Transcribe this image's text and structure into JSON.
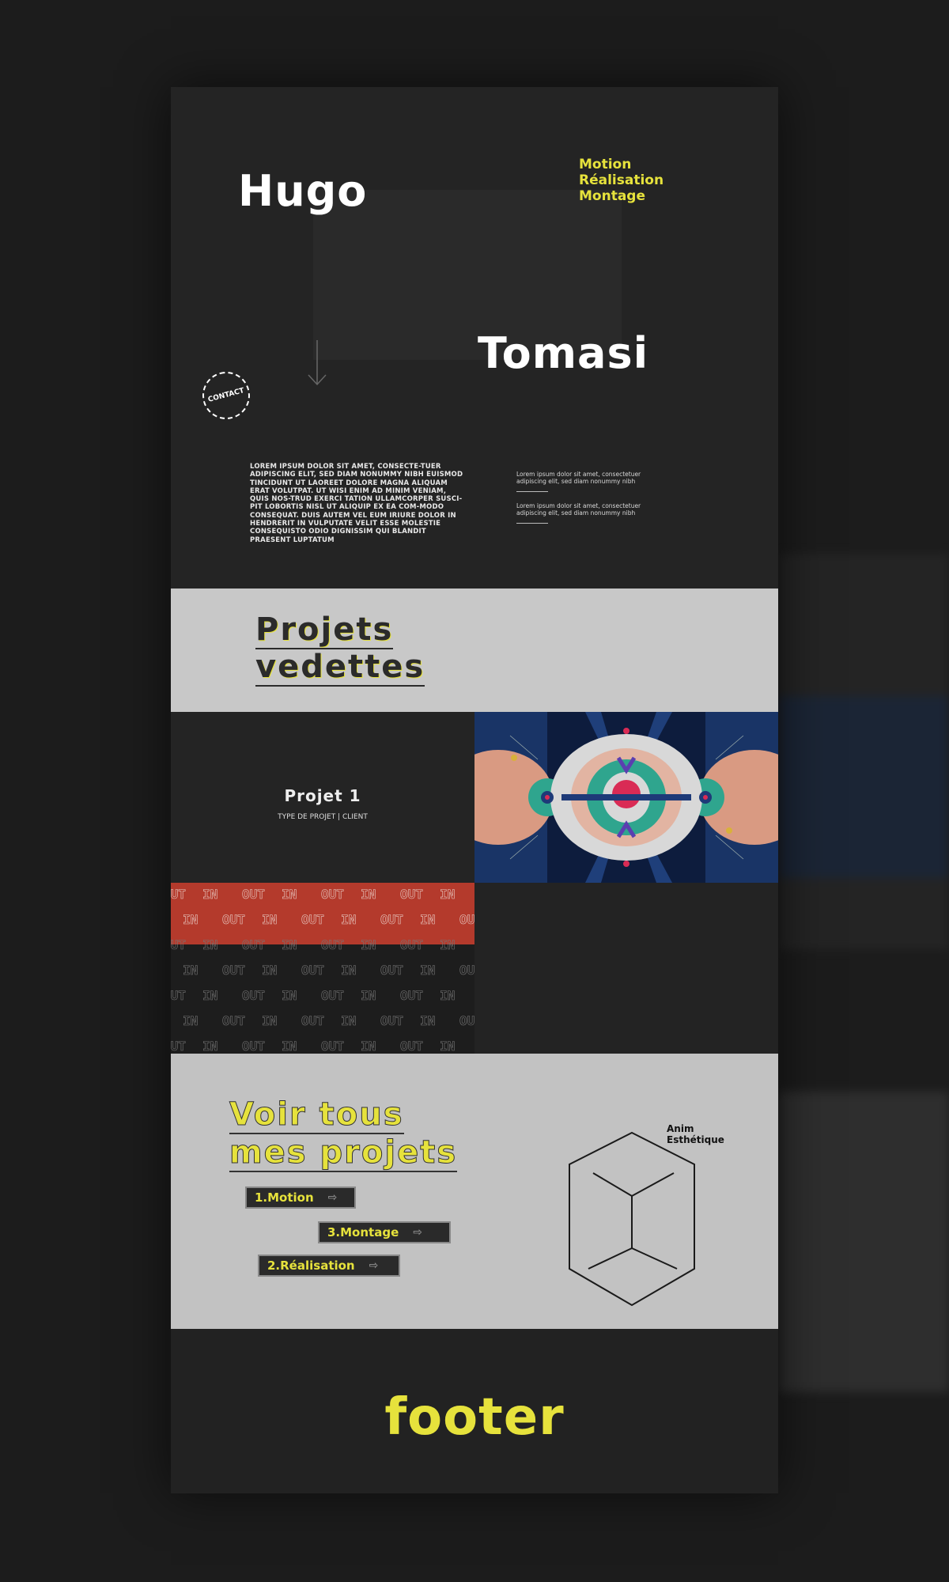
{
  "hero": {
    "first_name": "Hugo",
    "last_name": "Tomasi",
    "skills": [
      "Motion",
      "Réalisation",
      "Montage"
    ],
    "contact_label": "CONTACT",
    "intro": "LOREM IPSUM DOLOR SIT AMET, CONSECTE-TUER ADIPISCING ELIT, SED DIAM NONUMMY NIBH EUISMOD TINCIDUNT UT LAOREET DOLORE MAGNA ALIQUAM ERAT VOLUTPAT. UT WISI ENIM AD MINIM VENIAM, QUIS NOS-TRUD EXERCI TATION ULLAMCORPER SUSCI-PIT LOBORTIS NISL UT ALIQUIP EX EA COM-MODO CONSEQUAT. DUIS AUTEM VEL EUM IRIURE DOLOR IN HENDRERIT IN VULPUTATE VELIT ESSE MOLESTIE CONSEQUISTO ODIO DIGNISSIM QUI BLANDIT PRAESENT LUPTATUM",
    "side_notes": [
      "Lorem ipsum dolor sit amet, consectetuer adipiscing elit, sed diam nonummy nibh",
      "Lorem ipsum dolor sit amet, consectetuer adipiscing elit, sed diam nonummy nibh"
    ]
  },
  "featured": {
    "title_line1": "Projets",
    "title_line2": "vedettes"
  },
  "project1": {
    "title": "Projet 1",
    "meta": "TYPE DE PROJET | CLIENT"
  },
  "pattern_text": "OUT IN",
  "all_projects": {
    "title_line1": "Voir tous",
    "title_line2": "mes projets",
    "chips": [
      {
        "label": "1.Motion"
      },
      {
        "label": "3.Montage"
      },
      {
        "label": "2.Réalisation"
      }
    ],
    "anim_label_1": "Anim",
    "anim_label_2": "Esthétique"
  },
  "footer": {
    "label": "footer"
  },
  "colors": {
    "accent": "#e6e23c",
    "page": "#232323",
    "light": "#c8c8c8"
  }
}
